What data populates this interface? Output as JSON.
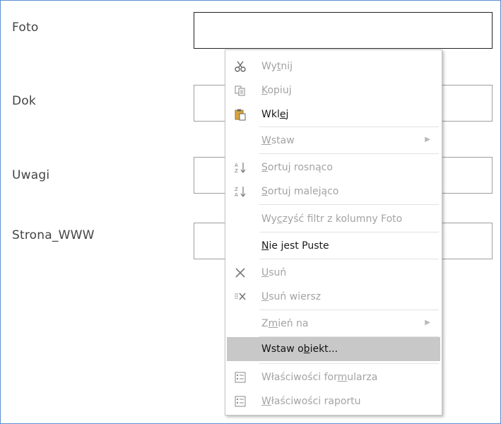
{
  "fields": [
    {
      "label": "Foto"
    },
    {
      "label": "Dok"
    },
    {
      "label": "Uwagi"
    },
    {
      "label": "Strona_WWW"
    }
  ],
  "context_menu": {
    "items": [
      {
        "pre": "Wy",
        "key": "t",
        "post": "nij",
        "icon": "scissors-icon",
        "enabled": false
      },
      {
        "pre": "",
        "key": "K",
        "post": "opiuj",
        "icon": "copy-icon",
        "enabled": false
      },
      {
        "pre": "Wkl",
        "key": "e",
        "post": "j",
        "icon": "paste-icon",
        "enabled": true
      },
      {
        "pre": "",
        "key": "W",
        "post": "staw",
        "icon": "",
        "enabled": false,
        "submenu": true
      },
      {
        "pre": "",
        "key": "S",
        "post": "ortuj rosnąco",
        "icon": "sort-ascending-icon",
        "enabled": false
      },
      {
        "pre": "",
        "key": "S",
        "post": "ortuj malejąco",
        "icon": "sort-descending-icon",
        "enabled": false
      },
      {
        "pre": "Wy",
        "key": "c",
        "post": "zyść filtr z kolumny Foto",
        "icon": "",
        "enabled": false
      },
      {
        "pre": "",
        "key": "N",
        "post": "ie jest Puste",
        "icon": "",
        "enabled": true
      },
      {
        "pre": "",
        "key": "U",
        "post": "suń",
        "icon": "delete-icon",
        "enabled": false
      },
      {
        "pre": "",
        "key": "U",
        "post": "suń wiersz",
        "icon": "delete-row-icon",
        "enabled": false
      },
      {
        "pre": "Z",
        "key": "m",
        "post": "ień na",
        "icon": "",
        "enabled": false,
        "submenu": true
      },
      {
        "pre": "Wstaw o",
        "key": "b",
        "post": "iekt...",
        "icon": "",
        "enabled": true,
        "highlighted": true
      },
      {
        "pre": "Właściwości for",
        "key": "m",
        "post": "ularza",
        "icon": "form-properties-icon",
        "enabled": false
      },
      {
        "pre": "",
        "key": "W",
        "post": "łaściwości raportu",
        "icon": "report-properties-icon",
        "enabled": false
      }
    ]
  },
  "colors": {
    "frame_border": "#5b8fd1",
    "highlight": "#c8c8c8",
    "disabled_text": "#a3a3a3",
    "enabled_text": "#1a1a1a"
  }
}
